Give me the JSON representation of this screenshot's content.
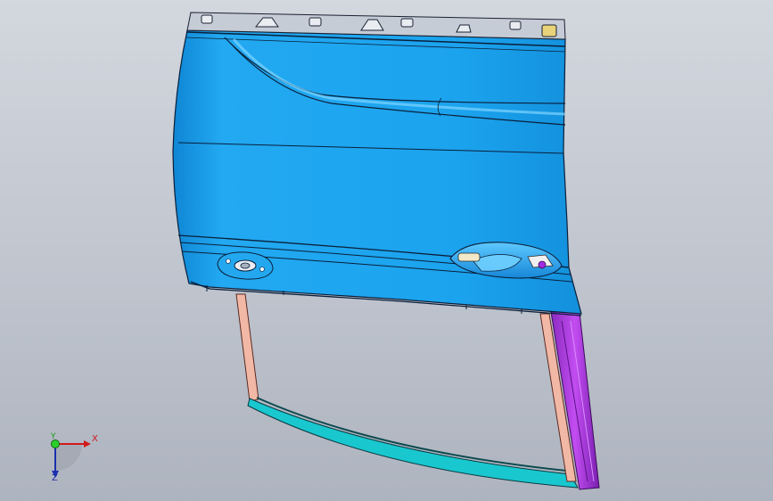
{
  "viewport": {
    "background_top": "#d3d7de",
    "background_bottom": "#aeb4bf"
  },
  "model": {
    "name": "car-door-assembly",
    "colors": {
      "outer_panel": "#1aa6ee",
      "outer_panel_shade": "#0f86d4",
      "edge_line": "#0a1f3a",
      "window_frame_left": "#f2b8a6",
      "window_frame_bottom": "#19c7cf",
      "guide_rail": "#b13ce0",
      "guide_rail_dark": "#7d22a8"
    }
  },
  "triad": {
    "x_label": "X",
    "y_label": "Y",
    "z_label": "Z",
    "x_color": "#d11a1a",
    "y_color": "#1a9a1a",
    "z_color": "#1a2fb0"
  }
}
